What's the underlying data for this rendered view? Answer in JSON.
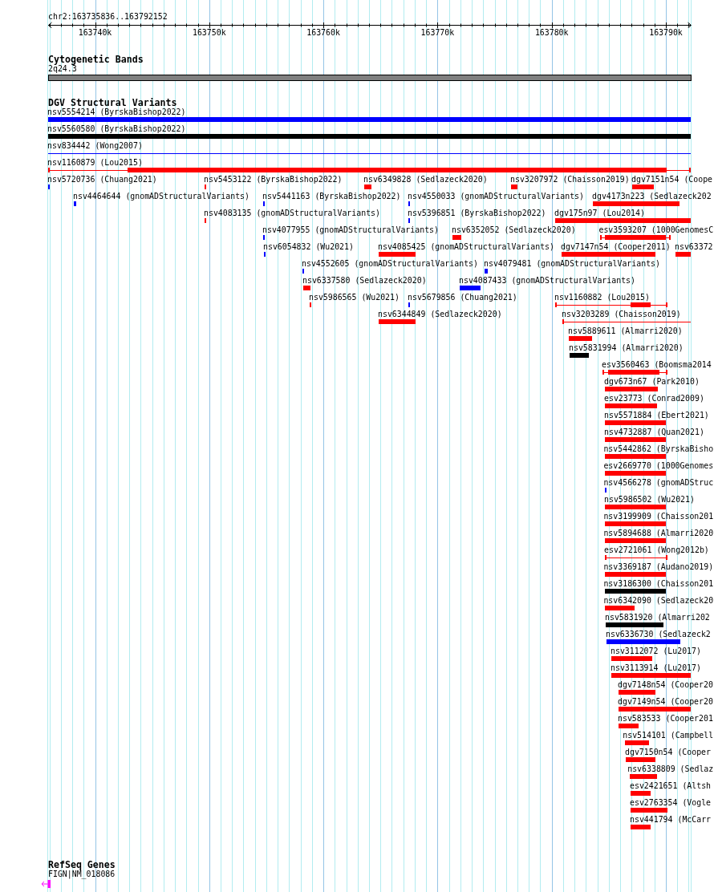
{
  "locus": "chr2:163735836..163792152",
  "ruler": {
    "ticks": [
      "163740k",
      "163750k",
      "163760k",
      "163770k",
      "163780k",
      "163790k"
    ]
  },
  "tracks": [
    {
      "kind": "cytoband",
      "title": "Cytogenetic Bands",
      "bands": [
        {
          "label": "2q24.3"
        }
      ]
    },
    {
      "kind": "variants",
      "title": "DGV Structural Variants",
      "features": [
        {
          "label": "nsv5554214 (ByrskaBishop2022)",
          "kind": "bar",
          "color": "#0000ff"
        },
        {
          "label": "nsv5560580 (ByrskaBishop2022)",
          "kind": "bar",
          "color": "#000000"
        },
        {
          "label": "nsv834442 (Wong2007)",
          "kind": "line",
          "color": "#0000ff"
        },
        {
          "label": "nsv1160879 (Lou2015)",
          "kind": "capped",
          "color": "#ff0000"
        },
        {
          "label": "nsv5720736 (Chuang2021)",
          "kind": "bar",
          "color": "#0000ff"
        },
        {
          "label": "nsv5453122 (ByrskaBishop2022)",
          "kind": "bar",
          "color": "#ff0000"
        },
        {
          "label": "nsv6349828 (Sedlazeck2020)",
          "kind": "bar",
          "color": "#ff0000"
        },
        {
          "label": "nsv3207972 (Chaisson2019)",
          "kind": "bar",
          "color": "#ff0000"
        },
        {
          "label": "dgv7151n54 (Coope",
          "kind": "bar",
          "color": "#ff0000"
        },
        {
          "label": "nsv4464644 (gnomADStructuralVariants)",
          "kind": "bar",
          "color": "#0000ff"
        },
        {
          "label": "nsv5441163 (ByrskaBishop2022)",
          "kind": "bar",
          "color": "#0000ff"
        },
        {
          "label": "nsv4550033 (gnomADStructuralVariants)",
          "kind": "bar",
          "color": "#0000ff"
        },
        {
          "label": "dgv4173n223 (Sedlazeck202",
          "kind": "bar",
          "color": "#ff0000"
        },
        {
          "label": "nsv4083135 (gnomADStructuralVariants)",
          "kind": "bar",
          "color": "#ff0000"
        },
        {
          "label": "nsv5396851 (ByrskaBishop2022)",
          "kind": "bar",
          "color": "#0000ff"
        },
        {
          "label": "dgv175n97 (Lou2014)",
          "kind": "bar",
          "color": "#ff0000"
        },
        {
          "label": "nsv4077955 (gnomADStructuralVariants)",
          "kind": "bar",
          "color": "#0000ff"
        },
        {
          "label": "nsv6352052 (Sedlazeck2020)",
          "kind": "bar",
          "color": "#ff0000"
        },
        {
          "label": "esv3593207 (1000GenomesC",
          "kind": "capped",
          "color": "#ff0000"
        },
        {
          "label": "nsv6054832 (Wu2021)",
          "kind": "bar",
          "color": "#0000ff"
        },
        {
          "label": "nsv4085425 (gnomADStructuralVariants)",
          "kind": "bar",
          "color": "#ff0000"
        },
        {
          "label": "dgv7147n54 (Cooper2011)",
          "kind": "bar",
          "color": "#ff0000"
        },
        {
          "label": "nsv63372",
          "kind": "bar",
          "color": "#ff0000"
        },
        {
          "label": "nsv4552605 (gnomADStructuralVariants)",
          "kind": "bar",
          "color": "#0000ff"
        },
        {
          "label": "nsv4079481 (gnomADStructuralVariants)",
          "kind": "bar",
          "color": "#0000ff"
        },
        {
          "label": "nsv6337580 (Sedlazeck2020)",
          "kind": "bar",
          "color": "#ff0000"
        },
        {
          "label": "nsv4087433 (gnomADStructuralVariants)",
          "kind": "bar",
          "color": "#0000ff"
        },
        {
          "label": "nsv5986565 (Wu2021)",
          "kind": "bar",
          "color": "#ff0000"
        },
        {
          "label": "nsv5679856 (Chuang2021)",
          "kind": "bar",
          "color": "#0000ff"
        },
        {
          "label": "nsv1160882 (Lou2015)",
          "kind": "capped",
          "color": "#ff0000"
        },
        {
          "label": "nsv6344849 (Sedlazeck2020)",
          "kind": "bar",
          "color": "#ff0000"
        },
        {
          "label": "nsv3203289 (Chaisson2019)",
          "kind": "capped",
          "color": "#ff0000"
        },
        {
          "label": "nsv5889611 (Almarri2020)",
          "kind": "bar",
          "color": "#ff0000"
        },
        {
          "label": "nsv5831994 (Almarri2020)",
          "kind": "bar",
          "color": "#000000"
        },
        {
          "label": "esv3560463 (Boomsma2014",
          "kind": "capped",
          "color": "#ff0000"
        },
        {
          "label": "dgv673n67 (Park2010)",
          "kind": "bar",
          "color": "#ff0000"
        },
        {
          "label": "esv23773 (Conrad2009)",
          "kind": "bar",
          "color": "#ff0000"
        },
        {
          "label": "nsv5571884 (Ebert2021)",
          "kind": "bar",
          "color": "#ff0000"
        },
        {
          "label": "nsv4732887 (Quan2021)",
          "kind": "bar",
          "color": "#ff0000"
        },
        {
          "label": "nsv5442862 (ByrskaBisho",
          "kind": "bar",
          "color": "#ff0000"
        },
        {
          "label": "esv2669770 (1000Genomes",
          "kind": "bar",
          "color": "#ff0000"
        },
        {
          "label": "nsv4566278 (gnomADStruc",
          "kind": "bar",
          "color": "#0000ff"
        },
        {
          "label": "nsv5986502 (Wu2021)",
          "kind": "bar",
          "color": "#ff0000"
        },
        {
          "label": "nsv3199909 (Chaisson201",
          "kind": "bar",
          "color": "#ff0000"
        },
        {
          "label": "nsv5894688 (Almarri2020",
          "kind": "bar",
          "color": "#ff0000"
        },
        {
          "label": "esv2721061 (Wong2012b)",
          "kind": "capped",
          "color": "#ff0000"
        },
        {
          "label": "nsv3369187 (Audano2019)",
          "kind": "bar",
          "color": "#ff0000"
        },
        {
          "label": "nsv3186300 (Chaisson201",
          "kind": "bar",
          "color": "#000000"
        },
        {
          "label": "nsv6342090 (Sedlazeck20",
          "kind": "bar",
          "color": "#ff0000"
        },
        {
          "label": "nsv5831920 (Almarri202",
          "kind": "bar",
          "color": "#000000"
        },
        {
          "label": "nsv6336730 (Sedlazeck2",
          "kind": "bar",
          "color": "#0000ff"
        },
        {
          "label": "nsv3112072 (Lu2017)",
          "kind": "bar",
          "color": "#ff0000"
        },
        {
          "label": "nsv3113914 (Lu2017)",
          "kind": "bar",
          "color": "#ff0000"
        },
        {
          "label": "dgv7148n54 (Cooper20",
          "kind": "bar",
          "color": "#ff0000"
        },
        {
          "label": "dgv7149n54 (Cooper20",
          "kind": "bar",
          "color": "#ff0000"
        },
        {
          "label": "nsv583533 (Cooper201",
          "kind": "bar",
          "color": "#ff0000"
        },
        {
          "label": "nsv514101 (Campbell",
          "kind": "bar",
          "color": "#ff0000"
        },
        {
          "label": "dgv7150n54 (Cooper",
          "kind": "bar",
          "color": "#ff0000"
        },
        {
          "label": "nsv6338809 (Sedlaz",
          "kind": "bar",
          "color": "#ff0000"
        },
        {
          "label": "esv2421651 (Altsh",
          "kind": "bar",
          "color": "#ff0000"
        },
        {
          "label": "esv2763354 (Vogle",
          "kind": "bar",
          "color": "#ff0000"
        },
        {
          "label": "nsv441794 (McCarr",
          "kind": "bar",
          "color": "#ff0000"
        }
      ]
    },
    {
      "kind": "genes",
      "title": "RefSeq Genes",
      "genes": [
        {
          "label": "FIGN|NM_018086"
        }
      ]
    }
  ]
}
